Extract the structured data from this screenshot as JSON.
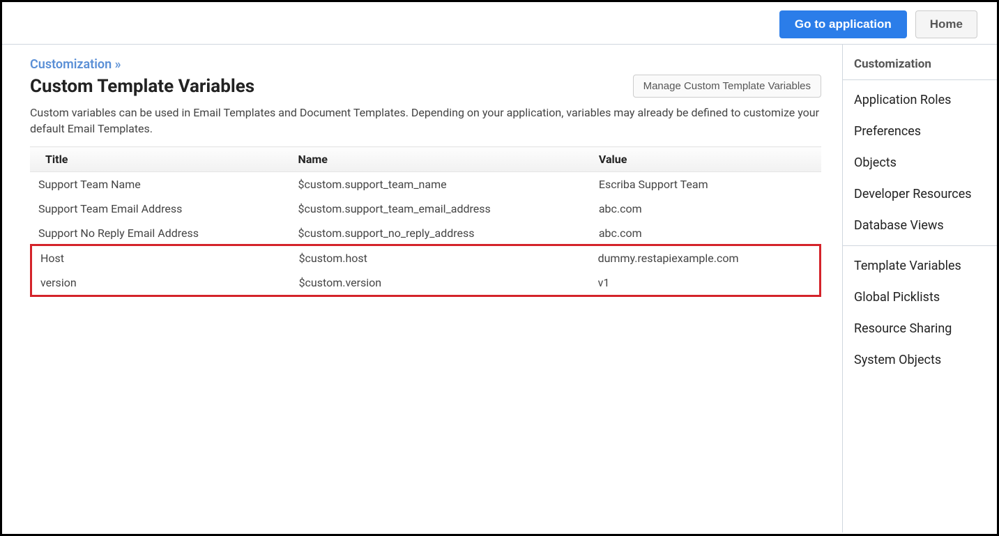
{
  "header": {
    "go_to_app": "Go to application",
    "home": "Home"
  },
  "breadcrumb": "Customization »",
  "page_title": "Custom Template Variables",
  "manage_button": "Manage Custom Template Variables",
  "description": "Custom variables can be used in Email Templates and Document Templates. Depending on your application, variables may already be defined to customize your default Email Templates.",
  "table": {
    "headers": {
      "title": "Title",
      "name": "Name",
      "value": "Value"
    },
    "rows": [
      {
        "title": "Support Team Name",
        "name": "$custom.support_team_name",
        "value": "Escriba Support Team"
      },
      {
        "title": "Support Team Email Address",
        "name": "$custom.support_team_email_address",
        "value": "abc.com"
      },
      {
        "title": "Support No Reply Email Address",
        "name": "$custom.support_no_reply_address",
        "value": "abc.com"
      },
      {
        "title": "Host",
        "name": "$custom.host",
        "value": "dummy.restapiexample.com"
      },
      {
        "title": "version",
        "name": "$custom.version",
        "value": "v1"
      }
    ]
  },
  "sidebar": {
    "header": "Customization",
    "section1": [
      "Application Roles",
      "Preferences",
      "Objects",
      "Developer Resources",
      "Database Views"
    ],
    "section2": [
      "Template Variables",
      "Global Picklists",
      "Resource Sharing",
      "System Objects"
    ]
  }
}
